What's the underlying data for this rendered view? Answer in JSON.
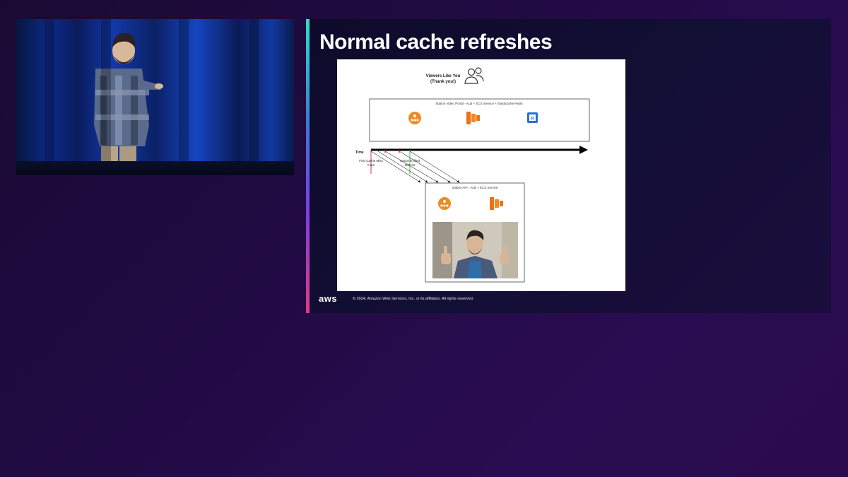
{
  "slide": {
    "title": "Normal cache refreshes",
    "diagram": {
      "viewers_line1": "Viewers Like You",
      "viewers_line2": "(Thank you!)",
      "portal_box_label": "Station Video Portal - ALB + ECS Service + Elasticache Redis",
      "time_label": "Time",
      "first_miss_line1": "First Cache Miss",
      "first_miss_line2": "0 ms",
      "cache_filled_line1": "Cache is filled",
      "cache_filled_line2": "500 ms",
      "api_box_label": "Station API - ALB + ECS Service",
      "redis_glyph": "R"
    },
    "footer": {
      "logo": "aws",
      "copyright": "© 2024, Amazon Web Services, Inc. or its affiliates. All rights reserved."
    }
  },
  "colors": {
    "background": "#220b45",
    "alb_orange": "#f08a24",
    "ecs_orange": "#e8741a",
    "redis_blue": "#2a6fd6",
    "miss_red": "#d0344a",
    "filled_green": "#3cc24a"
  },
  "icons": [
    "users-icon",
    "load-balancer-icon",
    "ecs-service-icon",
    "redis-icon",
    "aws-logo"
  ]
}
